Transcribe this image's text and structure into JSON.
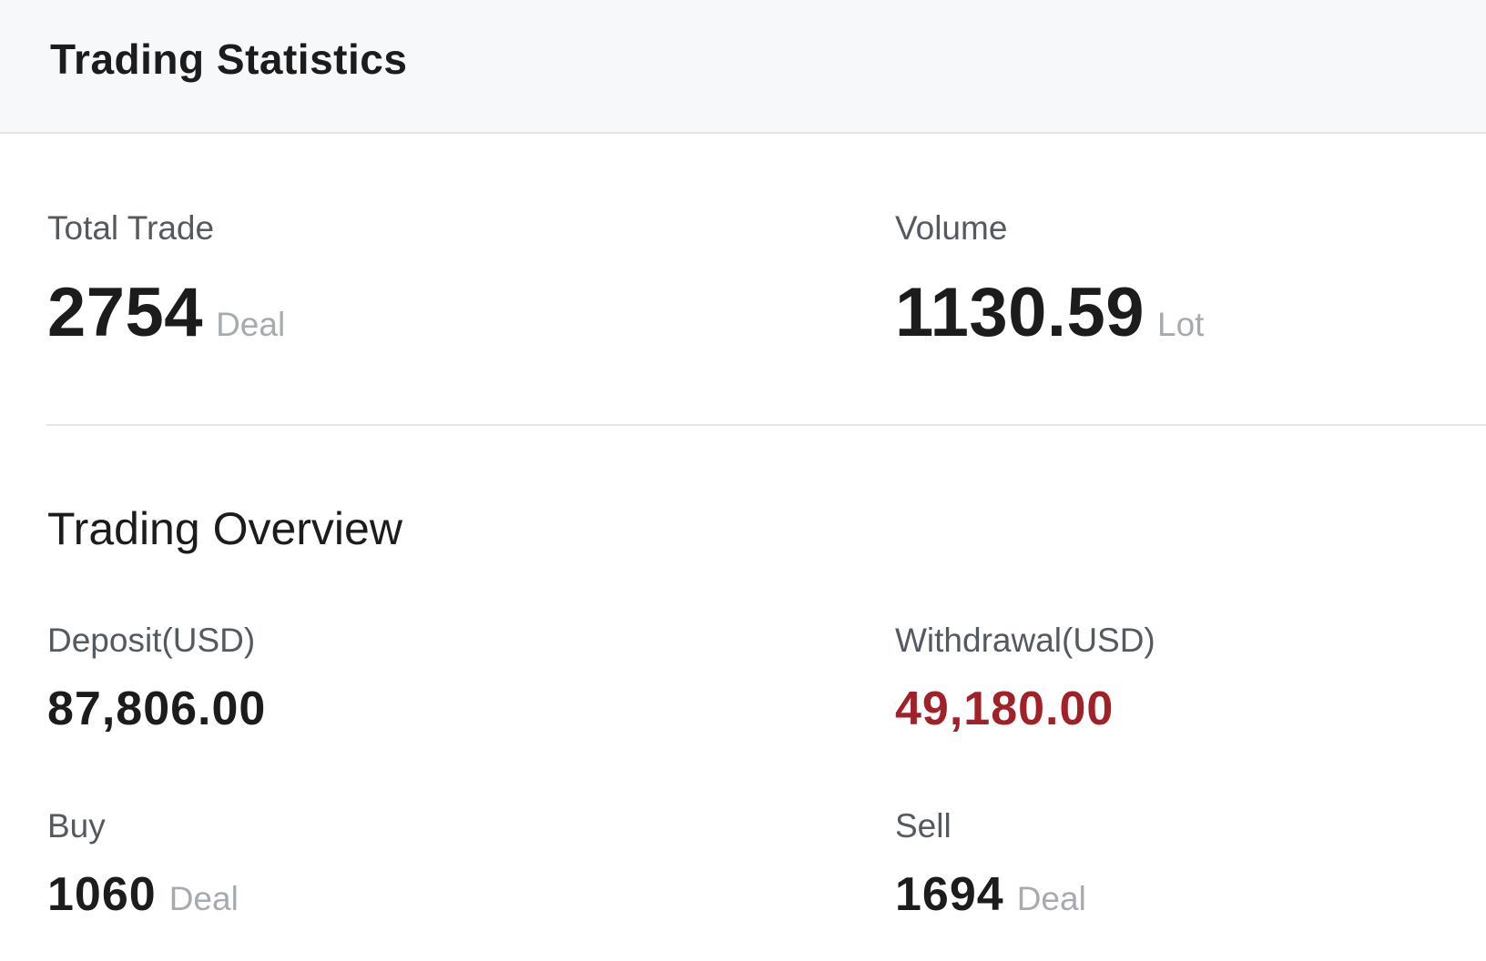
{
  "header": {
    "title": "Trading Statistics"
  },
  "summary": {
    "total_trade": {
      "label": "Total Trade",
      "value": "2754",
      "unit": "Deal"
    },
    "volume": {
      "label": "Volume",
      "value": "1130.59",
      "unit": "Lot"
    }
  },
  "overview": {
    "title": "Trading Overview",
    "deposit": {
      "label": "Deposit(USD)",
      "value": "87,806.00"
    },
    "withdrawal": {
      "label": "Withdrawal(USD)",
      "value": "49,180.00"
    },
    "buy": {
      "label": "Buy",
      "value": "1060",
      "unit": "Deal"
    },
    "sell": {
      "label": "Sell",
      "value": "1694",
      "unit": "Deal"
    }
  },
  "colors": {
    "header_bg": "#f7f8fa",
    "divider": "#e3e5e8",
    "withdrawal_value": "#a02128",
    "unit_text": "#a7abb0"
  }
}
